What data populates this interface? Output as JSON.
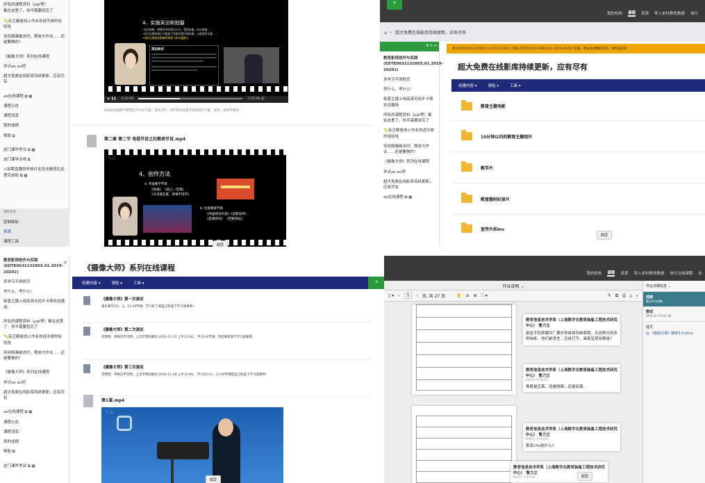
{
  "q1": {
    "sidebar_items": [
      "所有的课程资料（ppt等）",
      "都在这里了，你不需要就完了",
      "📏反正都是线上作业你逃不掉的哈哈哈",
      "待到病毒破去时，期末大作业……还是要做的！",
      "《摄像大师》系列在线课程",
      "学点ae au吧",
      "超大免费在线影库持续更新，应有尽有",
      "ae在线课程 ⧉ ▦",
      "课程公告",
      "课程消息",
      "我的成绩",
      "帮助 ⧉",
      "这门课咋考试 ⧉ ▦",
      "这门课学点啥 ⧉",
      "⚠如果直播的时候讨论没法做就在这里完成啦 ⧉ ▦"
    ],
    "sidebar_bottom": [
      "课程管理",
      "控制面板",
      "资源",
      "课程工具"
    ],
    "slide1_title": "4、实施采访和拍摄",
    "slide1_lines": [
      "•采访前期：需要有序的提问方式，策划准备，采访准备……",
      "•采访后期剪辑工作要靠于完整的提问和拍摄，以使选材丰富……",
      "•电视记者要具备敏锐观察力和沟通能力"
    ],
    "slide1_box_title": "采访样式",
    "video1_time": "0:33:58",
    "video1_total": "-1:25:08",
    "note": "本视频仅做教学使用且不允许下载，未经许可，请不要对该教学视频进行下载、复制、录屏传播等。",
    "item2_title": "第二章 第二节 电视节目之社教类节目.mp4",
    "slide2_title": "4、创作方法",
    "slide2_a": "A. 专类教学节目",
    "slide2_a1": "《央视》 《同上一堂课》",
    "slide2_a2": "《今天我在家，停课不停学》",
    "slide2_b": "B. 社会教育节目",
    "slide2_b1": "《中国诗词大会》《读者读书》",
    "slide2_b2": "《是真的吗》 《百家讲坛》",
    "screenshot_btn": "截屏"
  },
  "q2": {
    "nav": [
      "我的机构",
      "课程",
      "资源",
      "导入本科教务数据",
      "自行"
    ],
    "breadcrumb": "超大免费在线影库持续更新，应有尽有",
    "alert": "课 EDTE0031131991.01.2019-20201 | 目标 EDTE0031132803.01.2019-20202 完成。要访问详细的日志，请单击此处",
    "course_title": "教育影视创作与实践 (EDTE0031132803.01.2019-20202)",
    "sidebar_items": [
      "多学习不得挑页",
      "学什么、考什么！",
      "新晋主播上线高清无码不卡顿欢迎播场",
      "所有的课程资料（ppt等）都在这里了，你不需要就完了",
      "📏反正都是线上作业你逃不掉的哈哈哈",
      "待到病毒破去时，期末大作业……还是要做的！",
      "《摄像大师》系列在线课程",
      "学点ae au吧",
      "超大免费在线影库持续更新，应有尽有",
      "ae在线课程 ⧉ ▦"
    ],
    "page_title": "超大免费在线影库持续更新，应有尽有",
    "toolbar": [
      "创建内容 ▾",
      "测验 ▾",
      "工具 ▾"
    ],
    "folders": [
      "教育主题电影",
      "10分钟以内的教育主题短片",
      "教学片",
      "教育题材纪录片",
      "宣传片和mv"
    ],
    "screenshot_btn": "截屏"
  },
  "q3": {
    "course_title": "教育影视创作与实践 (EDTE0031132803.01.2019-20202)",
    "sidebar_items": [
      "多学习不得挑页",
      "学什么、考什么！",
      "新晋主播上线高清无码不卡顿欢迎播场",
      "所有的课程资料（ppt等）都在这里了，你不需要就完了",
      "📏反正都是线上作业你逃不掉的哈哈哈",
      "待到病毒破去时，期末大作业……还是要做的！",
      "《摄像大师》系列在线课程",
      "学点ae au吧",
      "超大免费在线影库持续更新，应有尽有",
      "ae在线课程 ⧉ ▦",
      "课程公告",
      "课程消息",
      "我的成绩",
      "帮助 ⧉",
      "这门课咋考试 ⧉ ▦"
    ],
    "page_title": "《摄像大师》系列在线课程",
    "toolbar": [
      "创建内容 ▾",
      "测验 ▾",
      "工具 ▾"
    ],
    "tests": [
      {
        "title": "《摄像大师》第一次测试",
        "desc": "请大家学习1、2、13-16节课，学习好了来自己检查下学习效果吧~"
      },
      {
        "title": "《摄像大师》第二次测试",
        "desc": "可用性：项目已不可用。上次可用日期为 2019-11-21 上午12:00。 学习3-9节课，然后来检测下学习成果吧"
      },
      {
        "title": "《摄像大师》第三次测试",
        "desc": "可用性：项目已不可用。上次可用日期为 2019-11-28 上午12:00。 学习10-12、17-20节课后自己检查下学习成果吧！"
      }
    ],
    "video_title": "第1课.mp4",
    "screenshot_btn": "截屏"
  },
  "q4": {
    "nav": [
      "我的机构",
      "课程",
      "资源",
      "导入本科教务数据",
      "自行注册课程",
      "在"
    ],
    "header": "作业说明",
    "pdf_page": "5",
    "pdf_total": "页, 共 27 页",
    "comments": [
      {
        "author": "教育信息技术学系（上海数字化教育装备工程技术研究中心） 鲁力立",
        "time": "",
        "text": "是给手机屏幕吗？要非常具体到画面哦。光说啊天就非常抽象。他们是语言，还是打字，画面呈现效果是？"
      },
      {
        "author": "教育信息技术学系（上海数字化教育装备工程技术研究中心） 鲁力立",
        "time": "6月1日 下午6:07",
        "text": "角度是正面，还是侧面，还是反面。"
      },
      {
        "author": "教育信息技术学系（上海数字化教育装备工程技术研究中心） 鲁力立",
        "time": "6月1日 下午6:14",
        "text": "那该15s放什么?"
      },
      {
        "author": "教育信息技术学系（上海数字化教育装备工程技术研究中心） 鲁力立",
        "time": "6月1日 下午6:19",
        "text": ""
      }
    ],
    "side_title": "作业详细信息 ⌄",
    "side_grade": "成绩",
    "side_grade_sub": "备注评分初稿",
    "side_try": "尝试",
    "side_try_time": "20-6-22 下午11:46",
    "side_submit": "提交",
    "side_file": "《她的口罩》脚本3.0.docx",
    "screenshot_btn": "截屏"
  },
  "colors": {
    "dark_nav": "#3a3a3a",
    "bb_blue": "#1f2a7a",
    "green": "#2e9a3e",
    "orange": "#f0a400",
    "folder": "#f2b632"
  }
}
